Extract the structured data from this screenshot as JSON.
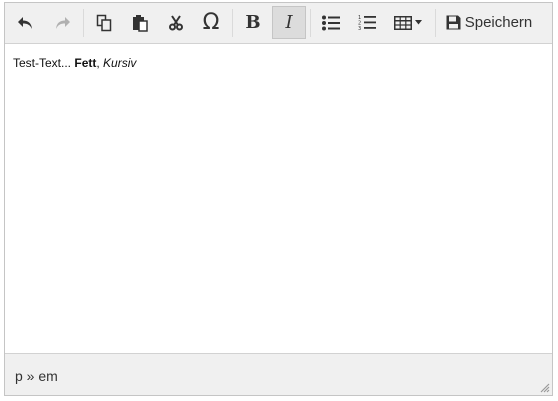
{
  "toolbar": {
    "undo": {
      "icon": "undo-icon"
    },
    "redo": {
      "icon": "redo-icon"
    },
    "copy": {
      "icon": "copy-icon"
    },
    "paste": {
      "icon": "paste-icon"
    },
    "cut": {
      "icon": "scissors-icon"
    },
    "special_char": {
      "icon": "omega-icon",
      "glyph": "Ω"
    },
    "bold": {
      "icon": "bold-icon",
      "glyph": "B"
    },
    "italic": {
      "icon": "italic-icon",
      "glyph": "I"
    },
    "bullet_list": {
      "icon": "bullet-list-icon"
    },
    "numbered_list": {
      "icon": "numbered-list-icon"
    },
    "table": {
      "icon": "table-icon"
    },
    "save": {
      "icon": "floppy-disk-icon",
      "label": "Speichern"
    }
  },
  "content": {
    "plain": "Test-Text... ",
    "bold": "Fett",
    "comma": ", ",
    "italic": "Kursiv"
  },
  "statusbar": {
    "path": "p » em"
  },
  "colors": {
    "toolbar_bg": "#f0f0f0",
    "active_bg": "#dcdcdc",
    "icon": "#333333",
    "disabled_icon": "#b0b0b0"
  }
}
